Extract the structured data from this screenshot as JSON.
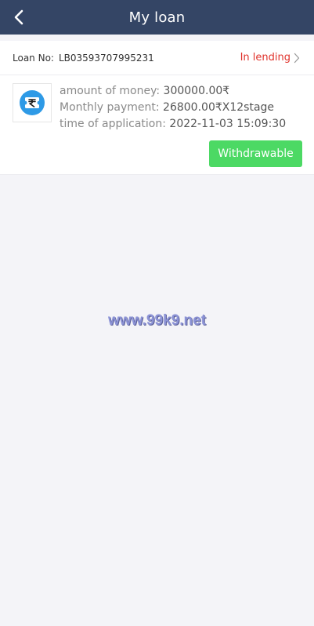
{
  "header": {
    "title": "My loan",
    "back_icon": "chevron-left-icon"
  },
  "loan": {
    "number_label": "Loan No:",
    "number": "LB03593707995231",
    "status": "In lending",
    "status_color": "#e0322b",
    "amount_label": "amount of money:",
    "amount": "300000.00₹",
    "monthly_label": "Monthly payment:",
    "monthly": "26800.00₹X12stage",
    "time_label": "time of application:",
    "time": "2022-11-03 15:09:30",
    "action_label": "Withdrawable",
    "action_color": "#4cd964",
    "logo_icon": "rupee-ticket-icon"
  },
  "watermark": {
    "text": "www.99k9.net"
  },
  "colors": {
    "header_bg": "#344565",
    "page_bg": "#f4f4f8"
  }
}
